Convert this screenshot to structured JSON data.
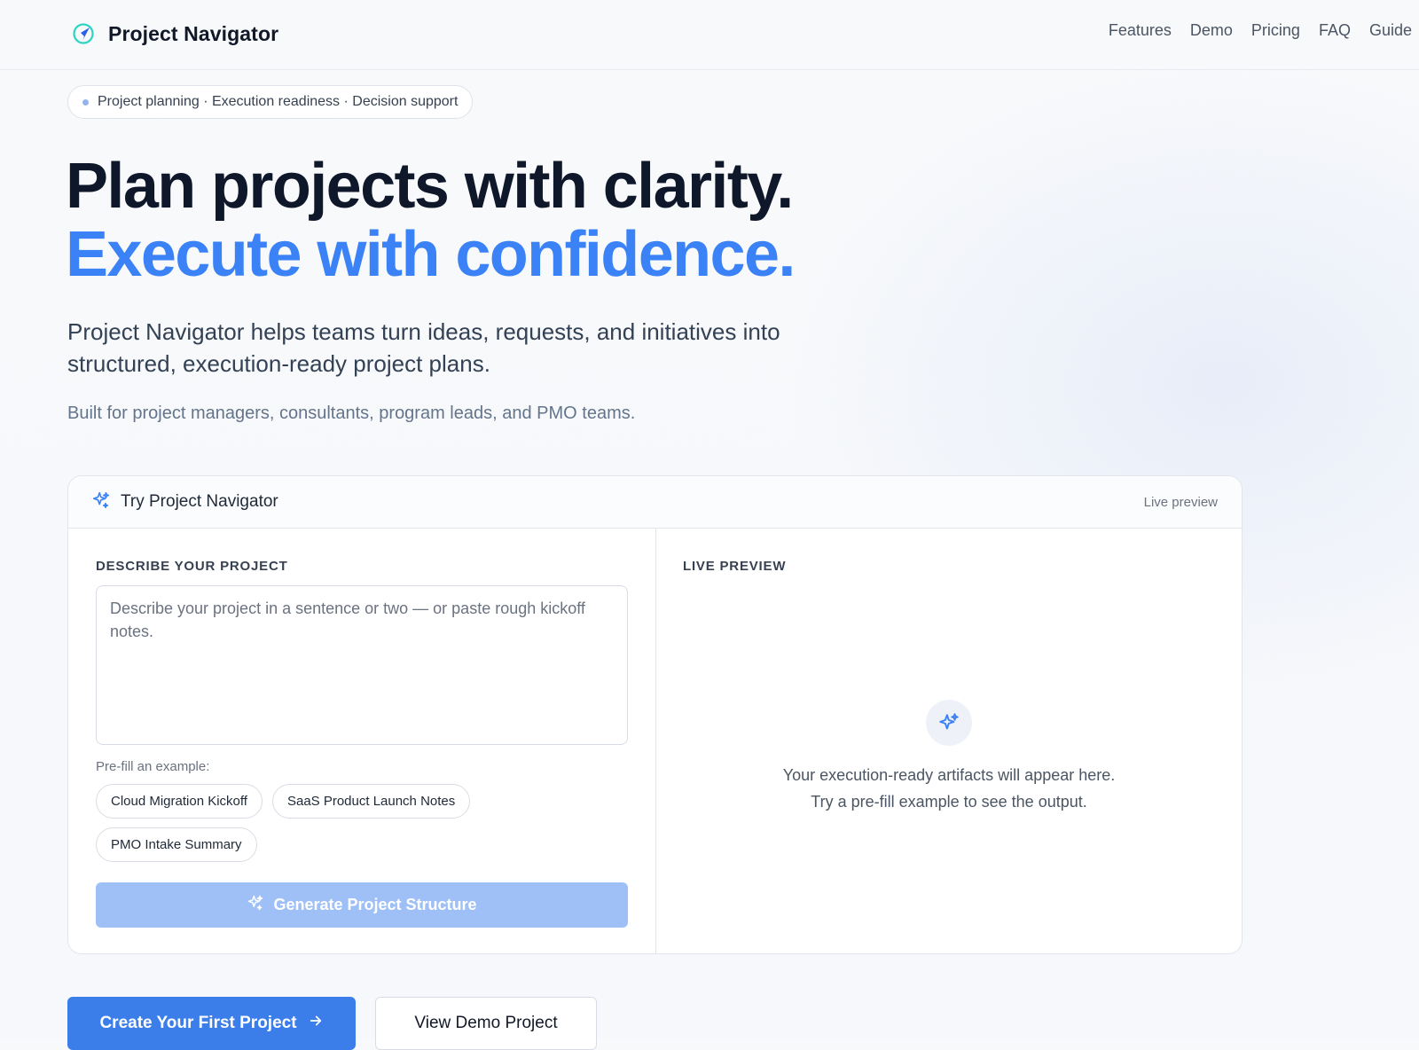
{
  "header": {
    "brand_name": "Project Navigator",
    "nav": [
      "Features",
      "Demo",
      "Pricing",
      "FAQ",
      "Guide"
    ]
  },
  "pill": {
    "text": "Project planning · Execution readiness · Decision support"
  },
  "hero": {
    "title_line1": "Plan projects with clarity.",
    "title_line2": "Execute with confidence.",
    "description": "Project Navigator helps teams turn ideas, requests, and initiatives into structured, execution-ready project plans.",
    "subtext": "Built for project managers, consultants, program leads, and PMO teams."
  },
  "try_card": {
    "title": "Try Project Navigator",
    "live_label": "Live preview",
    "input_section_label": "DESCRIBE YOUR PROJECT",
    "textarea_value": "",
    "textarea_placeholder": "Describe your project in a sentence or two — or paste rough kickoff notes.",
    "prefill_label": "Pre-fill an example:",
    "examples": [
      "Cloud Migration Kickoff",
      "SaaS Product Launch Notes",
      "PMO Intake Summary"
    ],
    "generate_label": "Generate Project Structure",
    "preview_section_label": "LIVE PREVIEW",
    "preview_empty_line1": "Your execution-ready artifacts will appear here.",
    "preview_empty_line2": "Try a pre-fill example to see the output."
  },
  "cta": {
    "primary_label": "Create Your First Project",
    "secondary_label": "View Demo Project"
  },
  "icons": {
    "brand_logo": "compass-icon",
    "sparkle": "sparkle-icon",
    "arrow": "arrow-right-icon"
  },
  "colors": {
    "accent": "#3b82f6",
    "accent_button": "#3b7eea",
    "disabled_button": "#9fc0f6",
    "title_dark": "#0f172a"
  }
}
